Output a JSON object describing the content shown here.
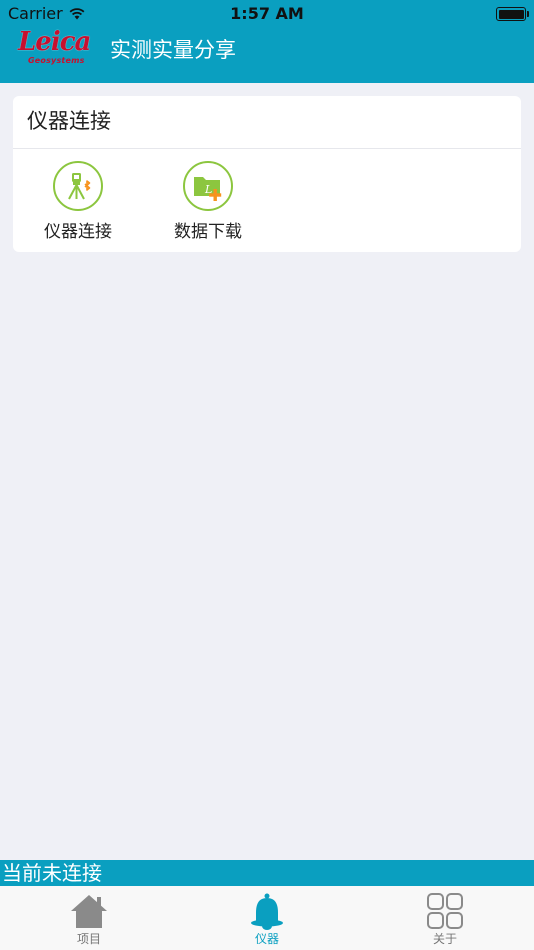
{
  "status_bar": {
    "carrier": "Carrier",
    "time": "1:57 AM"
  },
  "nav": {
    "logo_text": "Leica",
    "logo_sub": "Geosystems",
    "title": "实测实量分享"
  },
  "card": {
    "title": "仪器连接",
    "tiles": [
      {
        "label": "仪器连接",
        "icon": "total-station-bluetooth-icon"
      },
      {
        "label": "数据下载",
        "icon": "folder-add-icon"
      }
    ]
  },
  "connection": {
    "status_text": "当前未连接"
  },
  "tab_bar": {
    "active": 1,
    "tabs": [
      {
        "label": "项目",
        "icon": "home-icon"
      },
      {
        "label": "仪器",
        "icon": "bell-icon"
      },
      {
        "label": "关于",
        "icon": "grid-icon"
      }
    ]
  },
  "colors": {
    "brand_teal": "#0a9fc0",
    "accent_green": "#8cc63f",
    "accent_orange": "#f7931e",
    "leica_red": "#c8102e"
  }
}
